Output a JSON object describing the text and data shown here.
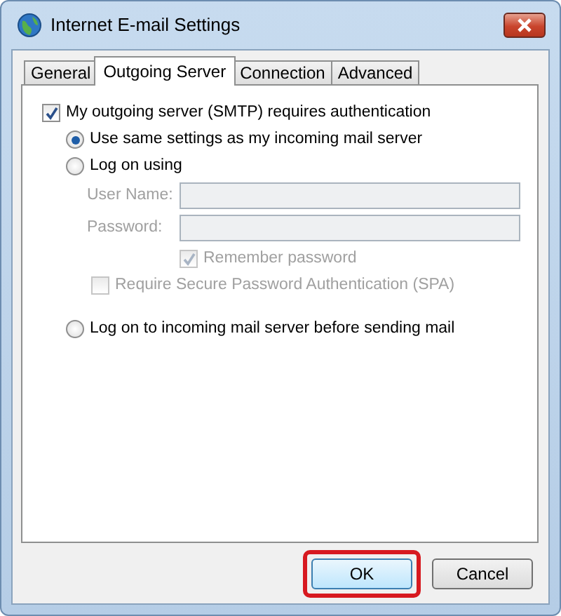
{
  "window": {
    "title": "Internet E-mail Settings"
  },
  "tabs": [
    {
      "label": "General",
      "selected": false
    },
    {
      "label": "Outgoing Server",
      "selected": true
    },
    {
      "label": "Connection",
      "selected": false
    },
    {
      "label": "Advanced",
      "selected": false
    }
  ],
  "authentication": {
    "label": "My outgoing server (SMTP) requires authentication",
    "checked": true
  },
  "login_options": [
    {
      "label": "Use same settings as my incoming mail server",
      "selected": true
    },
    {
      "label": "Log on using",
      "selected": false,
      "fields": [
        {
          "label": "User Name:",
          "disabled": true
        },
        {
          "label": "Password:",
          "disabled": true
        }
      ],
      "remember_password": {
        "label": "Remember password",
        "checked": true,
        "disabled": true
      },
      "spa": {
        "label": "Require Secure Password Authentication (SPA)",
        "checked": false,
        "disabled": true
      }
    },
    {
      "label": "Log on to incoming mail server before sending mail",
      "selected": false
    }
  ],
  "buttons": [
    {
      "label": "OK",
      "highlighted": true
    },
    {
      "label": "Cancel",
      "highlighted": false
    }
  ]
}
